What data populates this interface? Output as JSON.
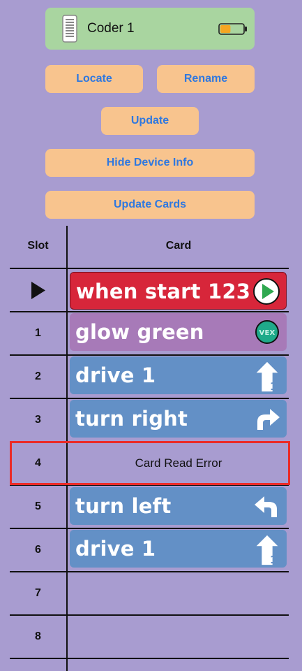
{
  "device": {
    "name": "Coder 1",
    "icon": "phone-icon",
    "battery_icon": "battery-low-icon",
    "battery_level": 0.45,
    "battery_color": "#f5a623"
  },
  "buttons": {
    "locate": "Locate",
    "rename": "Rename",
    "update": "Update",
    "hide_device_info": "Hide Device Info",
    "update_cards": "Update Cards"
  },
  "table": {
    "headers": {
      "slot": "Slot",
      "card": "Card"
    },
    "rows": [
      {
        "slot": "",
        "slot_icon": "play-triangle-icon",
        "card": "when start 123",
        "color": "#d7263a",
        "icon": "start-play-icon"
      },
      {
        "slot": "1",
        "card": "glow green",
        "color": "#a77ab8",
        "icon": "vex-logo-icon"
      },
      {
        "slot": "2",
        "card": "drive 1",
        "color": "#6390c6",
        "icon": "drive-forward-icon"
      },
      {
        "slot": "3",
        "card": "turn right",
        "color": "#6390c6",
        "icon": "turn-right-icon"
      },
      {
        "slot": "4",
        "card": "Card Read Error",
        "error": true,
        "highlight_color": "#ea2b28"
      },
      {
        "slot": "5",
        "card": "turn left",
        "color": "#6390c6",
        "icon": "turn-left-icon"
      },
      {
        "slot": "6",
        "card": "drive 1",
        "color": "#6390c6",
        "icon": "drive-forward-icon"
      },
      {
        "slot": "7",
        "card": ""
      },
      {
        "slot": "8",
        "card": ""
      }
    ]
  }
}
